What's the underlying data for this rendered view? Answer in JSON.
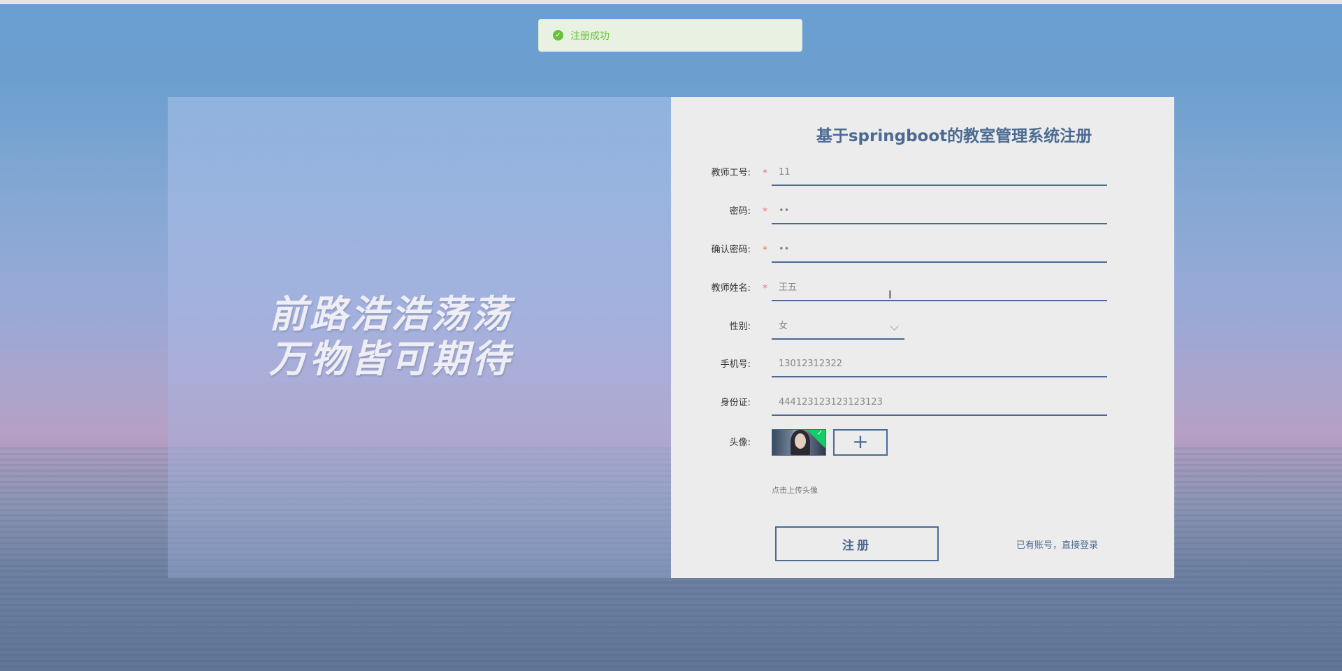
{
  "toast": {
    "icon": "success-check-icon",
    "text": "注册成功"
  },
  "slogan": {
    "line1": "前路浩浩荡荡",
    "line2": "万物皆可期待"
  },
  "form": {
    "title": "基于springboot的教室管理系统注册",
    "fields": [
      {
        "label": "教师工号:",
        "required": true,
        "value": "11"
      },
      {
        "label": "密码:",
        "required": true,
        "value": "••"
      },
      {
        "label": "确认密码:",
        "required": true,
        "value": "••"
      },
      {
        "label": "教师姓名:",
        "required": true,
        "value": "王五"
      },
      {
        "label": "性别:",
        "required": false,
        "value": "女"
      },
      {
        "label": "手机号:",
        "required": false,
        "value": "13012312322"
      },
      {
        "label": "身份证:",
        "required": false,
        "value": "444123123123123123"
      }
    ],
    "avatar_label": "头像:",
    "upload_plus": "+",
    "upload_hint": "点击上传头像",
    "required_mark": "*",
    "register_button": "注册",
    "login_link": "已有账号，直接登录"
  },
  "colors": {
    "accent": "#4c6a92",
    "success": "#67c23a",
    "required": "#f56c6c"
  }
}
